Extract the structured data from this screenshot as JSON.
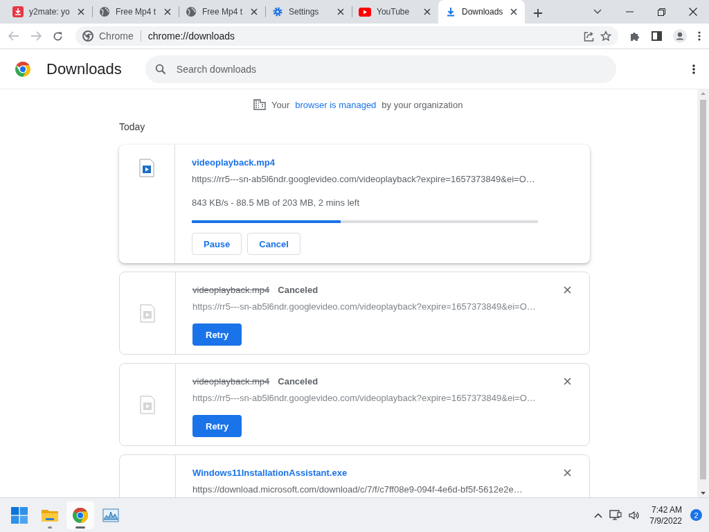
{
  "tabs": [
    {
      "title": "y2mate: yo",
      "kind": "y2mate",
      "selected": false
    },
    {
      "title": "Free Mp4 t",
      "kind": "web",
      "selected": false
    },
    {
      "title": "Free Mp4 t",
      "kind": "web",
      "selected": false
    },
    {
      "title": "Settings",
      "kind": "settings",
      "selected": false
    },
    {
      "title": "YouTube",
      "kind": "video",
      "selected": false
    },
    {
      "title": "Downloads",
      "kind": "downloads",
      "selected": true
    }
  ],
  "address_bar": {
    "site_chip": "Chrome",
    "url": "chrome://downloads"
  },
  "page": {
    "title": "Downloads",
    "search": {
      "placeholder": "Search downloads"
    },
    "managed_notice": {
      "before": "Your",
      "link": "browser is managed",
      "after": "by your organization"
    },
    "section": "Today",
    "downloads": [
      {
        "kind": "in_progress",
        "file_name": "videoplayback.mp4",
        "url": "https://rr5---sn-ab5l6ndr.googlevideo.com/videoplayback?expire=1657373849&ei=O…",
        "progress_text": "843 KB/s - 88.5 MB of 203 MB, 2 mins left",
        "level": 0.43,
        "buttons": [
          "Pause",
          "Cancel"
        ],
        "removable": false
      },
      {
        "kind": "canceled",
        "file_name": "videoplayback.mp4",
        "status": "Canceled",
        "url": "https://rr5---sn-ab5l6ndr.googlevideo.com/videoplayback?expire=1657373849&ei=O…",
        "buttons": [
          "Retry"
        ],
        "removable": true
      },
      {
        "kind": "canceled",
        "file_name": "videoplayback.mp4",
        "status": "Canceled",
        "url": "https://rr5---sn-ab5l6ndr.googlevideo.com/videoplayback?expire=1657373849&ei=O…",
        "buttons": [
          "Retry"
        ],
        "removable": true
      },
      {
        "kind": "installer",
        "file_name": "Windows11InstallationAssistant.exe",
        "url": "https://download.microsoft.com/download/c/7/f/c7ff08e9-094f-4e6d-bf5f-5612e2e…",
        "removable": true
      }
    ]
  },
  "taskbar": {
    "apps": [
      {
        "kind": "start",
        "running": false,
        "selected": false
      },
      {
        "kind": "folder",
        "running": true,
        "selected": false
      },
      {
        "kind": "chrome",
        "running": true,
        "selected": true
      },
      {
        "kind": "monitor",
        "running": false,
        "selected": false
      }
    ],
    "time": "7:42 AM",
    "date": "7/9/2022",
    "notification_count": "2"
  }
}
